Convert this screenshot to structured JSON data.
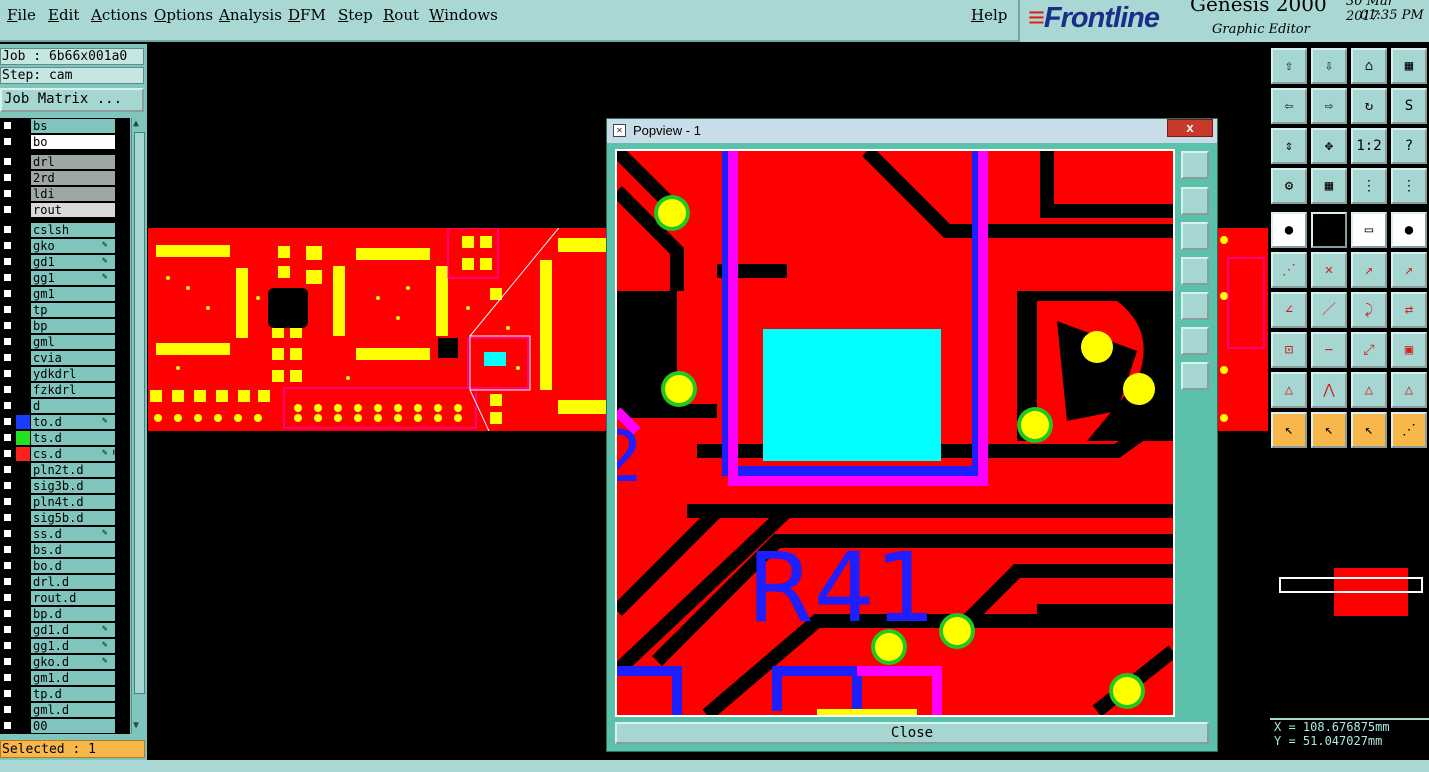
{
  "menu": {
    "file": "File",
    "edit": "Edit",
    "actions": "Actions",
    "options": "Options",
    "analysis": "Analysis",
    "dfm": "DFM",
    "step": "Step",
    "rout": "Rout",
    "windows": "Windows",
    "help": "Help"
  },
  "brand": {
    "logo": "Frontline",
    "product": "Genesis 2000",
    "subtitle": "Graphic Editor",
    "date": "30 Mar 2017",
    "time": "01:35 PM"
  },
  "job": {
    "label": "Job : 6b66x001a0",
    "step": "Step: cam",
    "job_matrix": "Job Matrix ..."
  },
  "layers": [
    {
      "name": "bs",
      "color": "#7fc5bd"
    },
    {
      "name": "bo",
      "color": "#ffffff"
    },
    {
      "name": "drl",
      "color": "#9ea6a6"
    },
    {
      "name": "2rd",
      "color": "#9ea6a6"
    },
    {
      "name": "ldi",
      "color": "#9ea6a6"
    },
    {
      "name": "rout",
      "color": "#d9d9d9"
    },
    {
      "name": "cslsh",
      "color": "#7fc5bd"
    },
    {
      "name": "gko",
      "color": "#7fc5bd",
      "mark": "✎"
    },
    {
      "name": "gd1",
      "color": "#7fc5bd",
      "mark": "✎"
    },
    {
      "name": "gg1",
      "color": "#7fc5bd",
      "mark": "✎"
    },
    {
      "name": "gm1",
      "color": "#7fc5bd"
    },
    {
      "name": "tp",
      "color": "#7fc5bd"
    },
    {
      "name": "bp",
      "color": "#7fc5bd"
    },
    {
      "name": "gml",
      "color": "#7fc5bd"
    },
    {
      "name": "cvia",
      "color": "#7fc5bd"
    },
    {
      "name": "ydkdrl",
      "color": "#7fc5bd"
    },
    {
      "name": "fzkdrl",
      "color": "#7fc5bd"
    },
    {
      "name": "d",
      "color": "#7fc5bd"
    },
    {
      "name": "to.d",
      "color": "#7fc5bd",
      "swatch": "#1a3cff",
      "mark": "✎"
    },
    {
      "name": "ts.d",
      "color": "#7fc5bd",
      "swatch": "#22e022"
    },
    {
      "name": "cs.d",
      "color": "#7fc5bd",
      "swatch": "#ff2020",
      "mark": "✎ ⊞"
    },
    {
      "name": "pln2t.d",
      "color": "#7fc5bd"
    },
    {
      "name": "sig3b.d",
      "color": "#7fc5bd"
    },
    {
      "name": "pln4t.d",
      "color": "#7fc5bd"
    },
    {
      "name": "sig5b.d",
      "color": "#7fc5bd"
    },
    {
      "name": "ss.d",
      "color": "#7fc5bd",
      "mark": "✎"
    },
    {
      "name": "bs.d",
      "color": "#7fc5bd"
    },
    {
      "name": "bo.d",
      "color": "#7fc5bd"
    },
    {
      "name": "drl.d",
      "color": "#7fc5bd"
    },
    {
      "name": "rout.d",
      "color": "#7fc5bd"
    },
    {
      "name": "bp.d",
      "color": "#7fc5bd"
    },
    {
      "name": "gd1.d",
      "color": "#7fc5bd",
      "mark": "✎"
    },
    {
      "name": "gg1.d",
      "color": "#7fc5bd",
      "mark": "✎"
    },
    {
      "name": "gko.d",
      "color": "#7fc5bd",
      "mark": "✎"
    },
    {
      "name": "gm1.d",
      "color": "#7fc5bd"
    },
    {
      "name": "tp.d",
      "color": "#7fc5bd"
    },
    {
      "name": "gml.d",
      "color": "#7fc5bd"
    },
    {
      "name": "00",
      "color": "#7fc5bd"
    }
  ],
  "status": {
    "selected": "Selected : 1"
  },
  "popview": {
    "title": "Popview - 1",
    "close_x": "x",
    "close_button": "Close",
    "refdes": "R41",
    "refdes_left": "2"
  },
  "coords": {
    "x": "X = 108.676875mm",
    "y": "Y = 51.047027mm"
  },
  "colors": {
    "board": "#ff0000",
    "pad": "#ffff00",
    "silkscreen": "#ff00ff",
    "outline": "#1e1eff",
    "selected_pad": "#00ffff",
    "panel": "#7fc5bd"
  },
  "toolbar_icons": [
    "view-home-icon",
    "view-down-icon",
    "house-icon",
    "grid-view-icon",
    "pan-left-icon",
    "pan-right-icon",
    "snap-icon",
    "s-curve-icon",
    "fit-icon",
    "center-icon",
    "one-to-two-icon",
    "help-icon",
    "measure-icon",
    "grid-icon",
    "layers-red-icon",
    "layers-blue-icon",
    "pad-icon",
    "polygon-icon",
    "ruler-icon",
    "circle-icon",
    "connect-icon",
    "cross-icon",
    "move-point-icon",
    "move-point-alt-icon",
    "line-icon",
    "slash-icon",
    "arc-icon",
    "text-flip-icon",
    "copy-icon",
    "minus-icon",
    "resize-icon",
    "array-icon",
    "triangle-icon",
    "triangle-a-icon",
    "triangle-b-icon",
    "triangle-c-icon",
    "pointer-icon",
    "pointer-box-icon",
    "pointer-select-icon",
    "pointer-node-icon"
  ]
}
